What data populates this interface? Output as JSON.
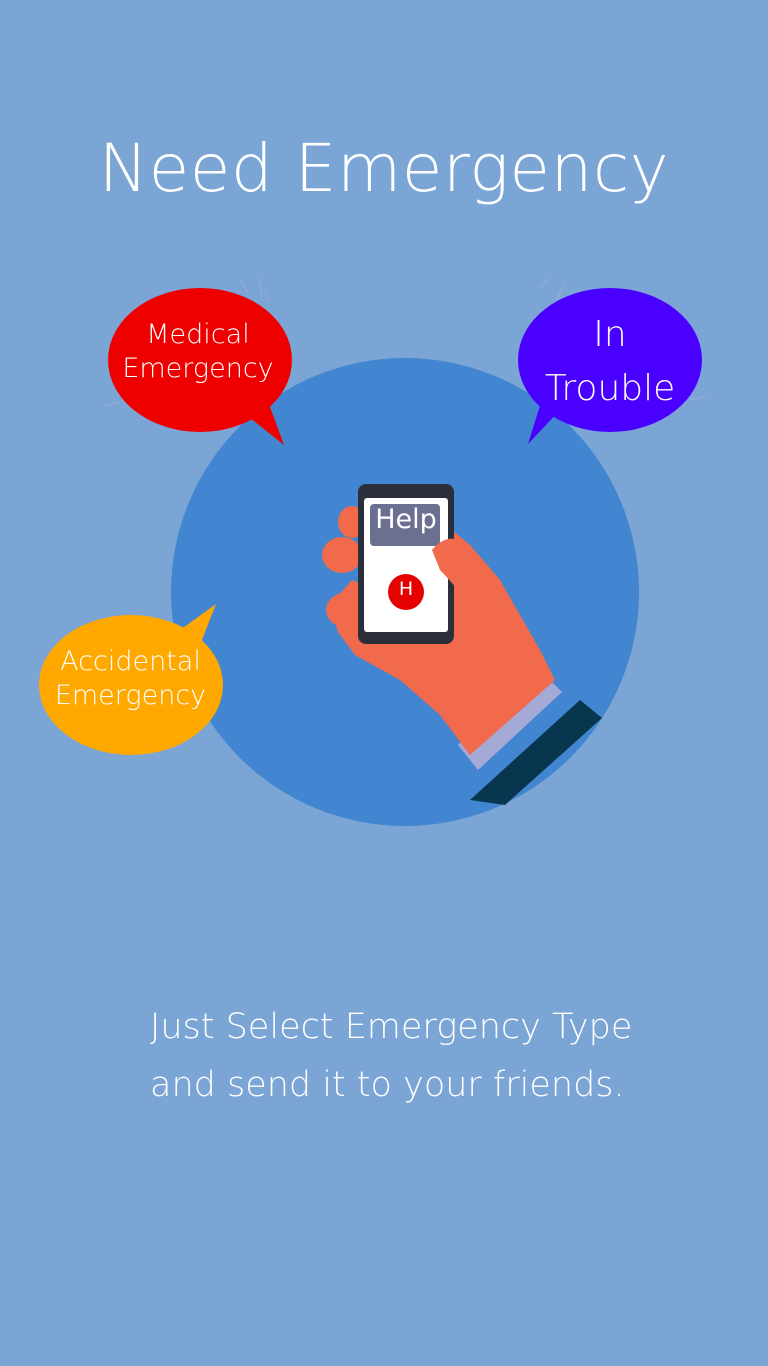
{
  "title": "Need Emergency",
  "bubbles": {
    "medical": {
      "line1": "Medical",
      "line2": "Emergency",
      "color": "#ee0000"
    },
    "trouble": {
      "line1": "In",
      "line2": "Trouble",
      "color": "#4a00ff"
    },
    "accidental": {
      "line1": "Accidental",
      "line2": "Emergency",
      "color": "#ffa800"
    }
  },
  "phone": {
    "help_label": "Help",
    "button_label": "H"
  },
  "description": {
    "line1": "Just Select Emergency Type",
    "line2": "and send it to your friends."
  },
  "colors": {
    "background": "#7aa5d4",
    "circle": "#4285d0",
    "hand": "#f06a4b",
    "sleeve": "#08364e",
    "cuff": "#a5a9d6"
  },
  "icons": [
    "hand-holding-phone-illustration",
    "speech-bubble-icon"
  ]
}
